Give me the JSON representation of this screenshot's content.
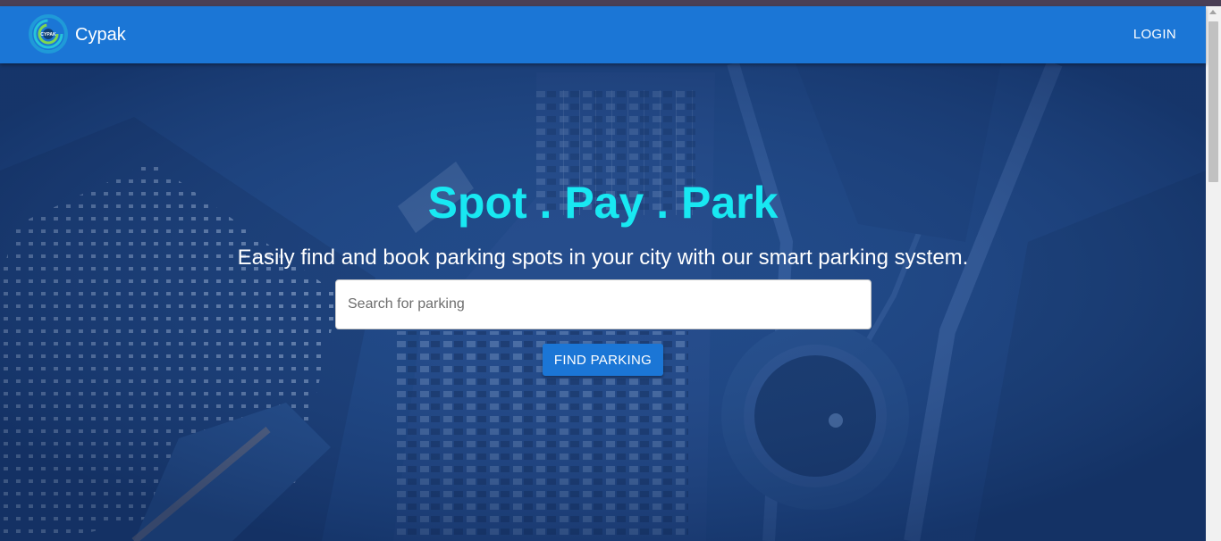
{
  "appbar": {
    "brand": "Cypak",
    "logo_text": "CYPAK",
    "login_label": "LOGIN"
  },
  "hero": {
    "title": "Spot . Pay . Park",
    "subtitle": "Easily find and book parking spots in your city with our smart parking system.",
    "search_placeholder": "Search for parking",
    "search_value": "",
    "button_label": "FIND PARKING"
  },
  "colors": {
    "appbar": "#1b76d6",
    "title": "#18e8f2",
    "overlay": "#1f4a8c"
  }
}
